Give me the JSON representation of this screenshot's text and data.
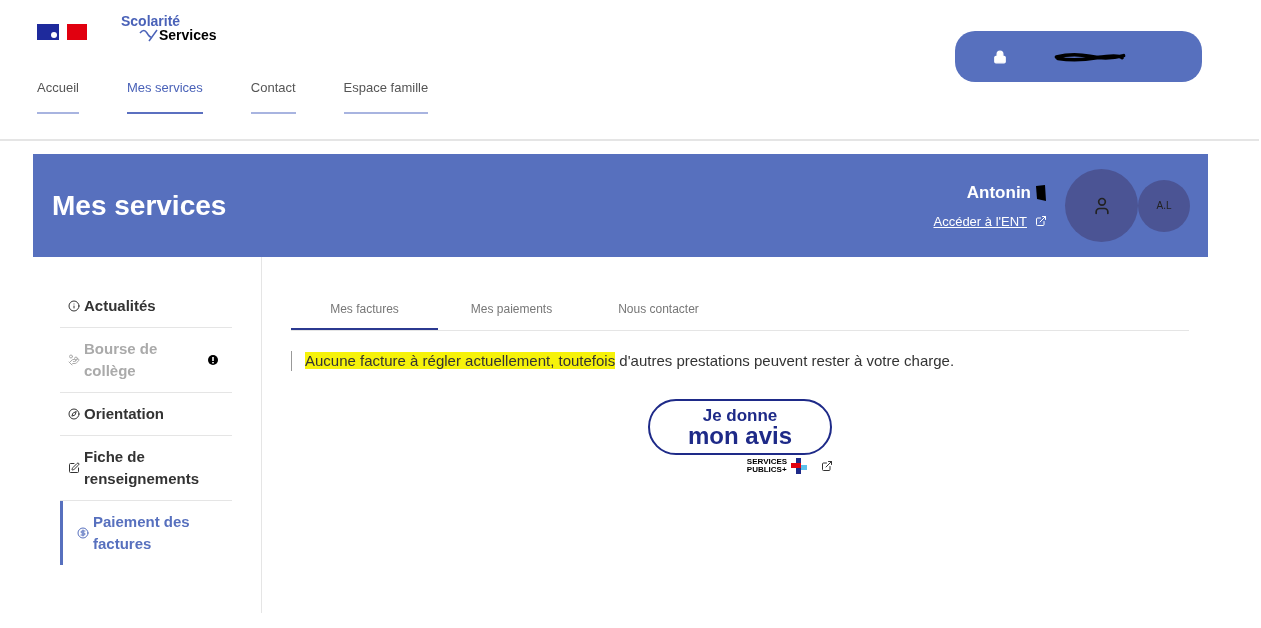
{
  "logo": {
    "line1": "Scolarité",
    "line2": "Services"
  },
  "nav": [
    {
      "label": "Accueil",
      "selected": false
    },
    {
      "label": "Mes services",
      "selected": true
    },
    {
      "label": "Contact",
      "selected": false
    },
    {
      "label": "Espace famille",
      "selected": false
    }
  ],
  "banner": {
    "title": "Mes services",
    "user_name": "Antonin",
    "ent_link": "Accéder à l'ENT",
    "initials": "A.L"
  },
  "sidebar": [
    {
      "label": "Actualités",
      "disabled": false,
      "selected": false,
      "alert": false
    },
    {
      "label": "Bourse de collège",
      "disabled": true,
      "selected": false,
      "alert": true
    },
    {
      "label": "Orientation",
      "disabled": false,
      "selected": false,
      "alert": false
    },
    {
      "label": "Fiche de renseignements",
      "disabled": false,
      "selected": false,
      "alert": false
    },
    {
      "label": "Paiement des factures",
      "disabled": false,
      "selected": true,
      "alert": false
    }
  ],
  "tabs": [
    {
      "label": "Mes factures",
      "selected": true
    },
    {
      "label": "Mes paiements",
      "selected": false
    },
    {
      "label": "Nous contacter",
      "selected": false
    }
  ],
  "notice": {
    "highlighted": "Aucune facture à régler actuellement, toutefois",
    "rest": " d'autres prestations peuvent rester à votre charge."
  },
  "feedback": {
    "line1": "Je donne",
    "line2": "mon avis",
    "brand_line1": "SERVICES",
    "brand_line2": "PUBLICS+"
  }
}
